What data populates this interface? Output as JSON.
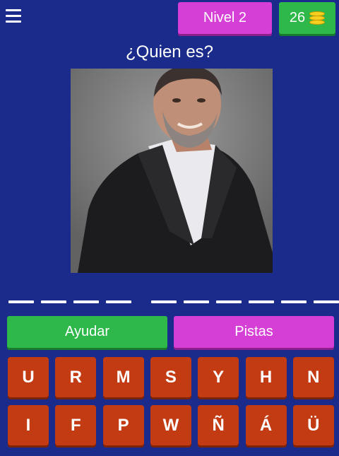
{
  "header": {
    "level_label": "Nivel 2",
    "coins": "26"
  },
  "question": "¿Quien es?",
  "answer_slots": {
    "word_lengths": [
      4,
      6
    ],
    "filled": ""
  },
  "actions": {
    "help_label": "Ayudar",
    "hints_label": "Pistas"
  },
  "keyboard": {
    "rows": [
      [
        "U",
        "R",
        "M",
        "S",
        "Y",
        "H",
        "N"
      ],
      [
        "I",
        "F",
        "P",
        "W",
        "Ñ",
        "Á",
        "Ü"
      ]
    ]
  },
  "colors": {
    "background": "#1a2b8c",
    "green": "#2eb84a",
    "magenta": "#d63fd6",
    "key": "#c33b12"
  }
}
